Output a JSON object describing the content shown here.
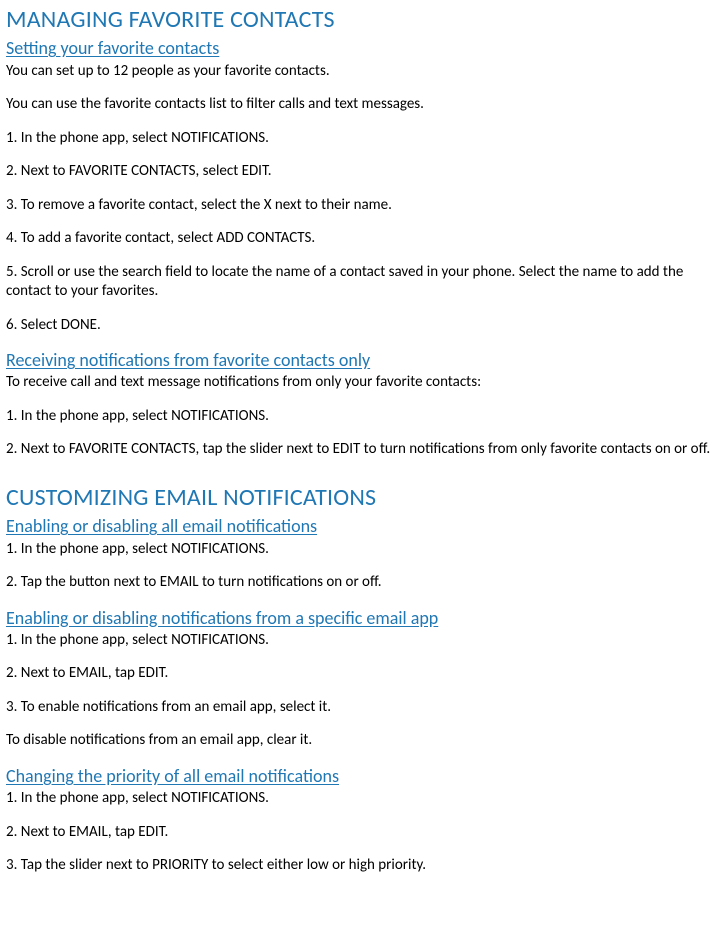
{
  "section1": {
    "title": "MANAGING FAVORITE CONTACTS",
    "sub1": {
      "title": "Setting your favorite contacts",
      "p1": "You can set up to 12 people as your favorite contacts.",
      "p2": "You can use the favorite contacts list to filter calls and text messages.",
      "p3": "1. In the phone app, select NOTIFICATIONS.",
      "p4": "2. Next to FAVORITE CONTACTS, select EDIT.",
      "p5": "3. To remove a favorite contact, select the X next to their name.",
      "p6": "4. To add a favorite contact, select ADD CONTACTS.",
      "p7": "5. Scroll or use the search field to locate the name of a contact saved in your phone. Select the name to add the contact to your favorites.",
      "p8": "6. Select DONE."
    },
    "sub2": {
      "title": "Receiving notifications from favorite contacts only",
      "p1": "To receive call and text message notifications from only your favorite contacts:",
      "p2": "1. In the phone app, select NOTIFICATIONS.",
      "p3": "2. Next to FAVORITE CONTACTS, tap the slider next to EDIT to turn notifications from only favorite contacts on or off."
    }
  },
  "section2": {
    "title": "CUSTOMIZING EMAIL NOTIFICATIONS",
    "sub1": {
      "title": "Enabling or disabling all email notifications",
      "p1": "1. In the phone app, select NOTIFICATIONS.",
      "p2": "2. Tap the button next to EMAIL to turn notifications on or off."
    },
    "sub2": {
      "title": "Enabling or disabling notifications from a specific email app",
      "p1": "1. In the phone app, select NOTIFICATIONS.",
      "p2": "2. Next to EMAIL, tap EDIT.",
      "p3": "3. To enable notifications from an email app, select it.",
      "p4": "To disable notifications from an email app, clear it."
    },
    "sub3": {
      "title": "Changing the priority of all email notifications",
      "p1": "1. In the phone app, select NOTIFICATIONS.",
      "p2": "2. Next to EMAIL, tap EDIT.",
      "p3": "3. Tap the slider next to PRIORITY to select either low or high priority."
    }
  }
}
